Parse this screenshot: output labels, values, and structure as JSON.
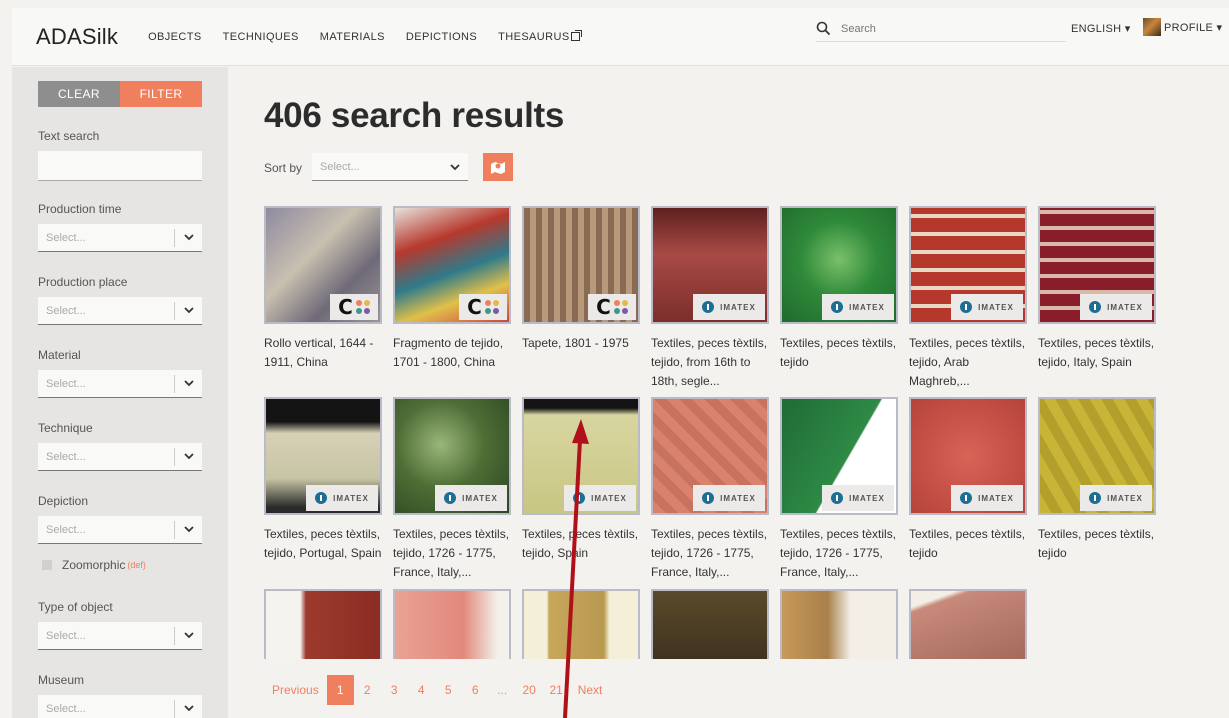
{
  "header": {
    "brand": "ADASilk",
    "nav": [
      "OBJECTS",
      "TECHNIQUES",
      "MATERIALS",
      "DEPICTIONS",
      "THESAURUS"
    ],
    "search_placeholder": "Search",
    "language": "ENGLISH ▾",
    "profile": "PROFILE ▾"
  },
  "sidebar": {
    "clear_label": "CLEAR",
    "filter_label": "FILTER",
    "text_search_label": "Text search",
    "select_placeholder": "Select...",
    "filters": [
      {
        "label": "Production time"
      },
      {
        "label": "Production place"
      },
      {
        "label": "Material"
      },
      {
        "label": "Technique"
      },
      {
        "label": "Depiction"
      },
      {
        "label": "Type of object"
      },
      {
        "label": "Museum"
      }
    ],
    "zoomorphic_label": "Zoomorphic",
    "zoomorphic_def": "(def)"
  },
  "main": {
    "results_title": "406 search results",
    "sort_label": "Sort by",
    "sort_placeholder": "Select...",
    "results": [
      {
        "caption": "Rollo vertical, 1644 - 1911, China",
        "source": "C"
      },
      {
        "caption": "Fragmento de tejido, 1701 - 1800, China",
        "source": "C"
      },
      {
        "caption": "Tapete, 1801 - 1975",
        "source": "C"
      },
      {
        "caption": "Textiles, peces tèxtils, tejido, from 16th to 18th, segle...",
        "source": "IMATEX"
      },
      {
        "caption": "Textiles, peces tèxtils, tejido",
        "source": "IMATEX"
      },
      {
        "caption": "Textiles, peces tèxtils, tejido, Arab Maghreb,...",
        "source": "IMATEX"
      },
      {
        "caption": "Textiles, peces tèxtils, tejido, Italy, Spain",
        "source": "IMATEX"
      },
      {
        "caption": "Textiles, peces tèxtils, tejido, Portugal, Spain",
        "source": "IMATEX"
      },
      {
        "caption": "Textiles, peces tèxtils, tejido, 1726 - 1775, France, Italy,...",
        "source": "IMATEX"
      },
      {
        "caption": "Textiles, peces tèxtils, tejido, Spain",
        "source": "IMATEX"
      },
      {
        "caption": "Textiles, peces tèxtils, tejido, 1726 - 1775, France, Italy,...",
        "source": "IMATEX"
      },
      {
        "caption": "Textiles, peces tèxtils, tejido, 1726 - 1775, France, Italy,...",
        "source": "IMATEX"
      },
      {
        "caption": "Textiles, peces tèxtils, tejido",
        "source": "IMATEX"
      },
      {
        "caption": "Textiles, peces tèxtils, tejido",
        "source": "IMATEX"
      }
    ],
    "pagination": {
      "previous": "Previous",
      "pages": [
        "1",
        "2",
        "3",
        "4",
        "5",
        "6",
        "...",
        "20",
        "21"
      ],
      "active": "1",
      "next": "Next"
    }
  },
  "badges": {
    "imatex_label": "IMATEX",
    "c_label": "C"
  },
  "colors": {
    "accent": "#f07f5e",
    "sidebar_bg": "#e6e5e3",
    "annotation_arrow": "#b0101a"
  }
}
